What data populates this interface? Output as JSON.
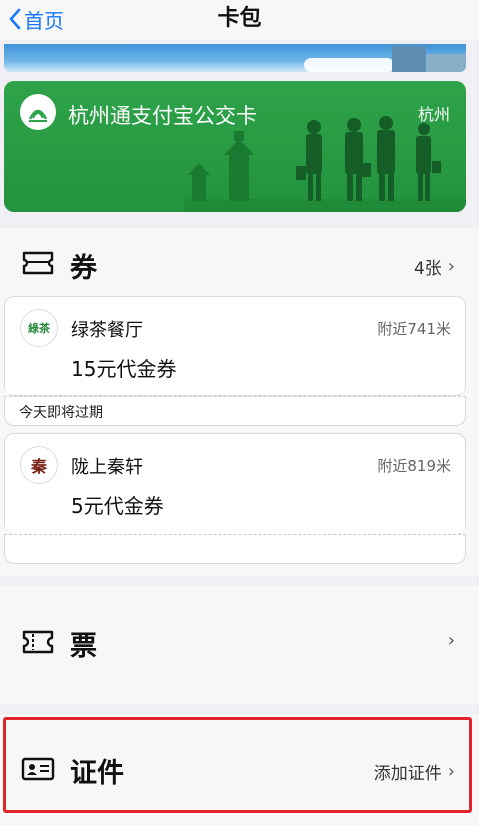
{
  "nav": {
    "back_label": "首页",
    "title": "卡包"
  },
  "bus_card": {
    "name": "杭州通支付宝公交卡",
    "city": "杭州"
  },
  "coupons": {
    "title": "券",
    "count": "4张",
    "items": [
      {
        "merchant": "绿茶餐厅",
        "logo_text": "綠茶",
        "distance": "附近741米",
        "amount": "15元代金券"
      },
      {
        "merchant": "陇上秦轩",
        "logo_text": "秦",
        "distance": "附近819米",
        "amount": "5元代金券"
      }
    ],
    "expiring_label": "今天即将过期"
  },
  "tickets": {
    "title": "票"
  },
  "certificates": {
    "title": "证件",
    "action": "添加证件"
  },
  "colors": {
    "accent": "#1677ff",
    "card_green": "#2ea34a",
    "highlight": "#e1232c"
  }
}
